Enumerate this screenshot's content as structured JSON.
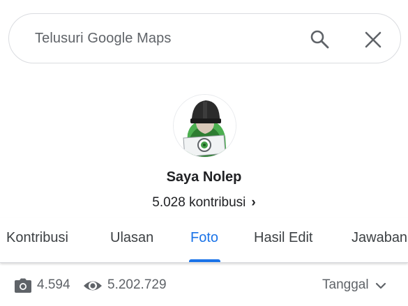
{
  "search": {
    "placeholder": "Telusuri Google Maps",
    "search_icon": "search-icon",
    "close_icon": "close-icon"
  },
  "profile": {
    "avatar_icon": "avatar",
    "name": "Saya Nolep",
    "contributions": "5.028 kontribusi",
    "chevron": "›"
  },
  "tabs": [
    {
      "label": "Kontribusi",
      "active": false
    },
    {
      "label": "Ulasan",
      "active": false
    },
    {
      "label": "Foto",
      "active": true
    },
    {
      "label": "Hasil Edit",
      "active": false
    },
    {
      "label": "Jawaban",
      "active": false
    }
  ],
  "stats": {
    "photos_icon": "camera-icon",
    "photos": "4.594",
    "views_icon": "eye-icon",
    "views": "5.202.729"
  },
  "sort": {
    "label": "Tanggal",
    "icon": "chevron-down-icon"
  },
  "colors": {
    "accent": "#1a73e8",
    "text_primary": "#202124",
    "text_secondary": "#5f6368",
    "border": "#dadce0"
  }
}
